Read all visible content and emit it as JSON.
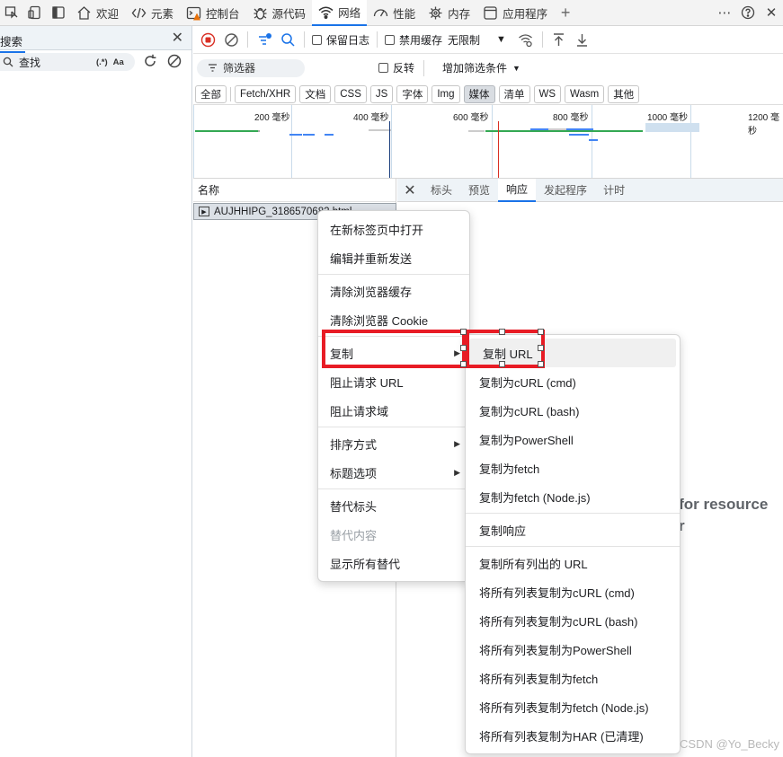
{
  "top_tabs": [
    {
      "label": "欢迎",
      "icon": "home-icon"
    },
    {
      "label": "元素",
      "icon": "code-icon"
    },
    {
      "label": "控制台",
      "icon": "console-icon"
    },
    {
      "label": "源代码",
      "icon": "bug-icon"
    },
    {
      "label": "网络",
      "icon": "wifi-icon",
      "active": true
    },
    {
      "label": "性能",
      "icon": "gauge-icon"
    },
    {
      "label": "内存",
      "icon": "memory-icon"
    },
    {
      "label": "应用程序",
      "icon": "app-icon"
    }
  ],
  "left_panel": {
    "title": "搜索",
    "search_value": "查找",
    "regex_label": "(.*)",
    "case_label": "Aa"
  },
  "toolbar": {
    "preserve_log": "保留日志",
    "disable_cache": "禁用缓存",
    "throttle": "无限制"
  },
  "filter": {
    "placeholder": "筛选器",
    "invert": "反转",
    "more_filters": "增加筛选条件"
  },
  "type_filters": [
    "全部",
    "Fetch/XHR",
    "文档",
    "CSS",
    "JS",
    "字体",
    "Img",
    "媒体",
    "清单",
    "WS",
    "Wasm",
    "其他"
  ],
  "timeline": {
    "labels": [
      "200 毫秒",
      "400 毫秒",
      "600 毫秒",
      "800 毫秒",
      "1000 毫秒",
      "1200 毫秒"
    ]
  },
  "requests": {
    "header": "名称",
    "row_name": "AUJHHIPG_3186570682.html"
  },
  "details": {
    "tabs": [
      "标头",
      "预览",
      "响应",
      "发起程序",
      "计时"
    ],
    "active_tab": 2,
    "message_line1": "d for resource",
    "message_line2": "r"
  },
  "menu_main": [
    {
      "label": "在新标签页中打开"
    },
    {
      "label": "编辑并重新发送"
    },
    {
      "sep": true
    },
    {
      "label": "清除浏览器缓存"
    },
    {
      "label": "清除浏览器 Cookie"
    },
    {
      "sep": true
    },
    {
      "label": "复制",
      "submenu": true
    },
    {
      "label": "阻止请求 URL"
    },
    {
      "label": "阻止请求域"
    },
    {
      "sep": true
    },
    {
      "label": "排序方式",
      "submenu": true
    },
    {
      "label": "标题选项",
      "submenu": true
    },
    {
      "sep": true
    },
    {
      "label": "替代标头"
    },
    {
      "label": "替代内容",
      "disabled": true
    },
    {
      "label": "显示所有替代"
    }
  ],
  "menu_copy": [
    {
      "label": "复制 URL",
      "highlight": true
    },
    {
      "label": "复制为cURL (cmd)"
    },
    {
      "label": "复制为cURL (bash)"
    },
    {
      "label": "复制为PowerShell"
    },
    {
      "label": "复制为fetch"
    },
    {
      "label": "复制为fetch (Node.js)"
    },
    {
      "sep": true
    },
    {
      "label": "复制响应"
    },
    {
      "sep": true
    },
    {
      "label": "复制所有列出的 URL"
    },
    {
      "label": "将所有列表复制为cURL (cmd)"
    },
    {
      "label": "将所有列表复制为cURL (bash)"
    },
    {
      "label": "将所有列表复制为PowerShell"
    },
    {
      "label": "将所有列表复制为fetch"
    },
    {
      "label": "将所有列表复制为fetch (Node.js)"
    },
    {
      "label": "将所有列表复制为HAR (已清理)"
    }
  ],
  "watermark": "CSDN @Yo_Becky",
  "colors": {
    "accent": "#1a73e8",
    "annotation": "#e81c25",
    "record": "#d93025",
    "selected_row": "#dbe0e6"
  }
}
